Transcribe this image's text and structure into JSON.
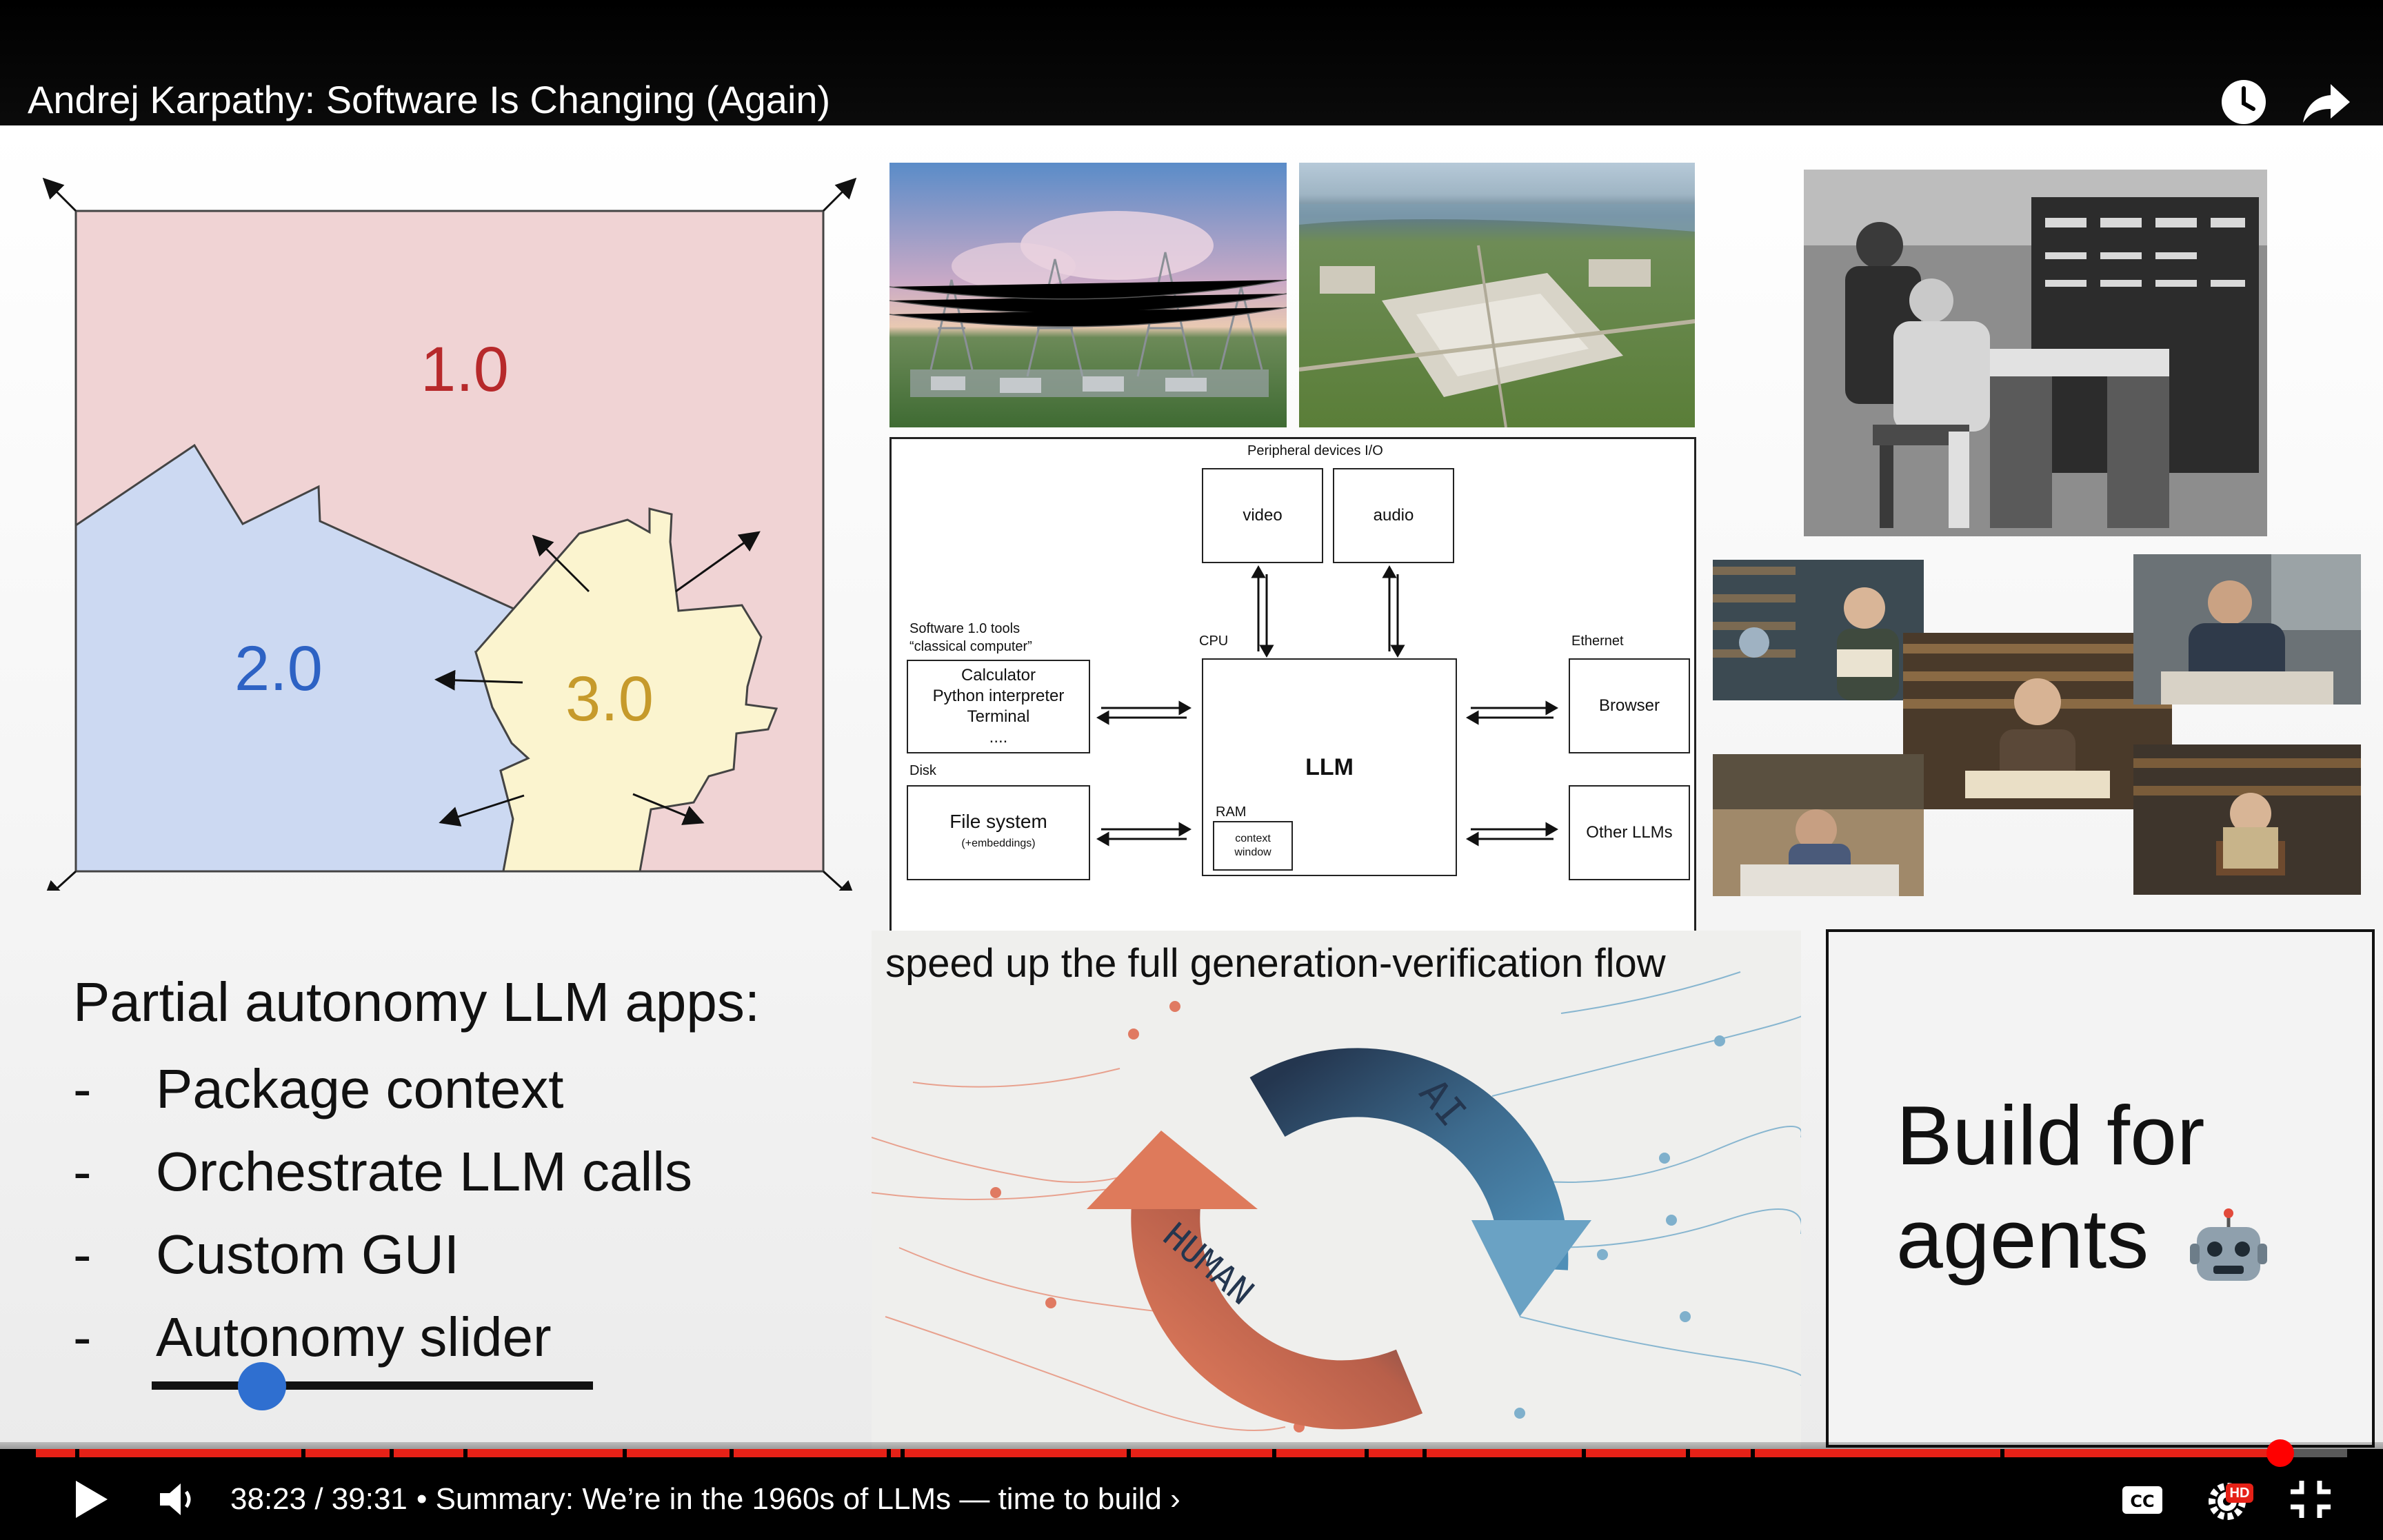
{
  "player": {
    "title": "Andrej Karpathy: Software Is Changing (Again)",
    "current_time": "38:23",
    "duration": "39:31",
    "time_separator": " / ",
    "chapter": "• Summary: We’re in the 1960s of LLMs — time to build",
    "chapter_chevron": "›",
    "progress_fraction": 0.971,
    "chapter_marks": [
      0.017,
      0.115,
      0.153,
      0.185,
      0.254,
      0.3,
      0.368,
      0.374,
      0.472,
      0.535,
      0.575,
      0.6,
      0.669,
      0.714,
      0.742,
      0.85
    ],
    "icons": {
      "watch_later": "clock-icon",
      "share": "share-arrow-icon",
      "play": "play-icon",
      "volume": "volume-icon",
      "captions": "cc-icon",
      "settings": "gear-icon",
      "hd_badge": "HD",
      "exit_fullscreen": "exit-fullscreen-icon"
    },
    "colors": {
      "progress_played": "#e62117",
      "scrubber": "#ff0000",
      "hd_badge": "#e62117"
    }
  },
  "slide": {
    "software_versions": {
      "v1": "1.0",
      "v2": "2.0",
      "v3": "3.0",
      "colors": {
        "v1_fill": "#f0d3d4",
        "v2_fill": "#ccd9f2",
        "v3_fill": "#fbf4cf",
        "v1_text": "#b7292b",
        "v2_text": "#2d62c4",
        "v3_text": "#c69a2b"
      }
    },
    "llm_os": {
      "peripheral_label": "Peripheral devices I/O",
      "video": "video",
      "audio": "audio",
      "cpu_label": "CPU",
      "llm": "LLM",
      "ram_label": "RAM",
      "context_window_line1": "context",
      "context_window_line2": "window",
      "sw1_label_line1": "Software 1.0 tools",
      "sw1_label_line2": "“classical computer”",
      "tools_line1": "Calculator",
      "tools_line2": "Python interpreter",
      "tools_line3": "Terminal",
      "tools_line4": "....",
      "disk_label": "Disk",
      "fs_line1": "File system",
      "fs_line2": "(+embeddings)",
      "ethernet_label": "Ethernet",
      "browser": "Browser",
      "other_llms": "Other LLMs"
    },
    "autonomy": {
      "heading": "Partial autonomy LLM apps:",
      "dash": "-",
      "items": [
        "Package context",
        "Orchestrate LLM calls",
        "Custom GUI",
        "Autonomy slider"
      ],
      "slider_value": 0.25
    },
    "flow": {
      "caption": "speed up the full generation-verification flow",
      "ai_label": "AI",
      "human_label": "HUMAN",
      "colors": {
        "ai": "#4f8fb7",
        "human": "#de7a5b",
        "dark": "#24364f"
      }
    },
    "agents": {
      "line1": "Build for",
      "line2": "agents",
      "icon": "robot-icon"
    }
  }
}
